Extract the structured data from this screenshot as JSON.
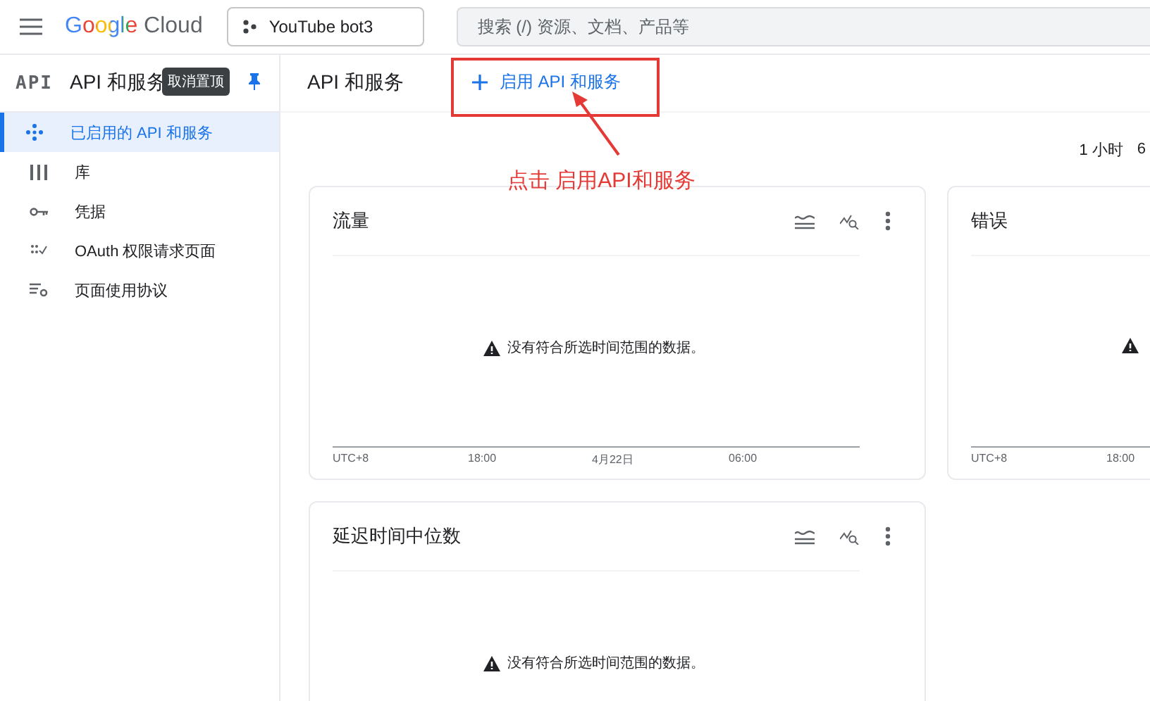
{
  "header": {
    "logo": "Google Cloud",
    "project": "YouTube bot3",
    "search": {
      "placeholder": "搜索 (/) 资源、文档、产品等"
    }
  },
  "sidebar": {
    "logo_text": "API",
    "title": "API 和服务",
    "tooltip": "取消置顶",
    "pinned": true,
    "items": [
      {
        "label": "已启用的 API 和服务",
        "selected": true
      },
      {
        "label": "库",
        "selected": false
      },
      {
        "label": "凭据",
        "selected": false
      },
      {
        "label": "OAuth 权限请求页面",
        "selected": false
      },
      {
        "label": "页面使用协议",
        "selected": false
      }
    ]
  },
  "page": {
    "title": "API 和服务",
    "enable_button": "启用 API 和服务"
  },
  "annotation": {
    "text": "点击 启用API和服务"
  },
  "time_range": [
    "1 小时",
    "6"
  ],
  "cards": [
    {
      "title": "流量",
      "message": "没有符合所选时间范围的数据。",
      "axis_labels": [
        "UTC+8",
        "18:00",
        "4月22日",
        "06:00"
      ]
    },
    {
      "title": "错误",
      "axis_labels": [
        "UTC+8",
        "18:00"
      ]
    },
    {
      "title": "延迟时间中位数",
      "message": "没有符合所选时间范围的数据。"
    }
  ]
}
